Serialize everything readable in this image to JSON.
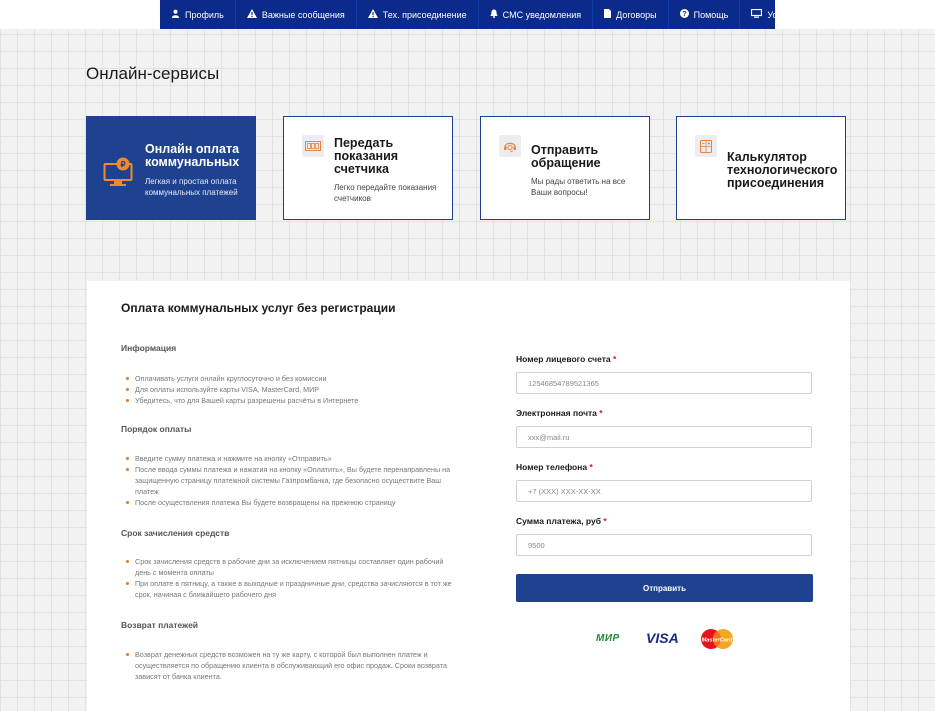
{
  "nav": {
    "items": [
      {
        "label": "Профиль",
        "icon": "user-icon"
      },
      {
        "label": "Важные сообщения",
        "icon": "warning-icon"
      },
      {
        "label": "Тех. присоединение",
        "icon": "warning-icon"
      },
      {
        "label": "СМС уведомления",
        "icon": "bell-icon"
      },
      {
        "label": "Договоры",
        "icon": "document-icon"
      },
      {
        "label": "Помощь",
        "icon": "help-icon"
      },
      {
        "label": "Услуги",
        "icon": "monitor-icon"
      }
    ]
  },
  "page": {
    "title": "Онлайн-сервисы"
  },
  "cards": [
    {
      "title": "Онлайн оплата коммунальных",
      "desc": "Легкая и простая оплата коммунальных платежей",
      "icon": "payment-monitor-icon"
    },
    {
      "title": "Передать показания счетчика",
      "desc": "Легко передайте показания счетчиков",
      "icon": "meter-icon"
    },
    {
      "title": "Отправить обращение",
      "desc": "Мы рады ответить на все Ваши вопросы!",
      "icon": "support-icon"
    },
    {
      "title": "Калькулятор технологического присоединения",
      "desc": "",
      "icon": "calculator-icon"
    }
  ],
  "panel": {
    "title": "Оплата коммунальных услуг без регистрации",
    "sections": [
      {
        "heading": "Информация",
        "items": [
          "Оплачивать услуги онлайн круглосуточно и без комиссии",
          "Для оплаты используйте карты VISA, MasterCard, МИР",
          "Убедитесь, что для Вашей карты разрешены расчёты в Интернете"
        ]
      },
      {
        "heading": "Порядок оплаты",
        "items": [
          "Введите сумму платежа и нажмите на кнопку «Отправить»",
          "После ввода суммы платежа и нажатия на кнопку «Оплатить», Вы будете перенаправлены на защищенную страницу платежной системы Газпромбанка, где безопасно осуществите Ваш платеж",
          "После осуществления платежа Вы будете возвращены на прежнюю страницу"
        ]
      },
      {
        "heading": "Срок зачисления средств",
        "items": [
          "Срок зачисления средств в рабочие дни за исключением пятницы составляет один рабочий день с момента оплаты",
          "При оплате в пятницу, а также в выходные и праздничные дни, средства зачисляются в тот же срок, начиная с ближайшего рабочего дня"
        ]
      },
      {
        "heading": "Возврат платежей",
        "items": [
          "Возврат денежных средств возможен на ту же карту, с которой был выполнен платеж и осуществляется по обращению клиента в обслуживающий его офис продаж. Сроки возврата зависят от банка клиента."
        ]
      }
    ]
  },
  "form": {
    "required_mark": "*",
    "account": {
      "label": "Номер лицевого счета",
      "placeholder": "12546854789521365"
    },
    "email": {
      "label": "Электронная почта",
      "placeholder": "xxx@mail.ru"
    },
    "phone": {
      "label": "Номер телефона",
      "placeholder": "+7 (XXX) XXX-XX-XX"
    },
    "amount": {
      "label": "Сумма платежа, руб",
      "placeholder": "9500"
    },
    "submit": "Отправить"
  },
  "payment_logos": {
    "mir": "МИР",
    "visa": "VISA",
    "mastercard": "MasterCard"
  },
  "colors": {
    "nav_bg": "#0a2a8c",
    "accent": "#1e4190",
    "bullet": "#e07b2a",
    "required": "#dd1111"
  }
}
